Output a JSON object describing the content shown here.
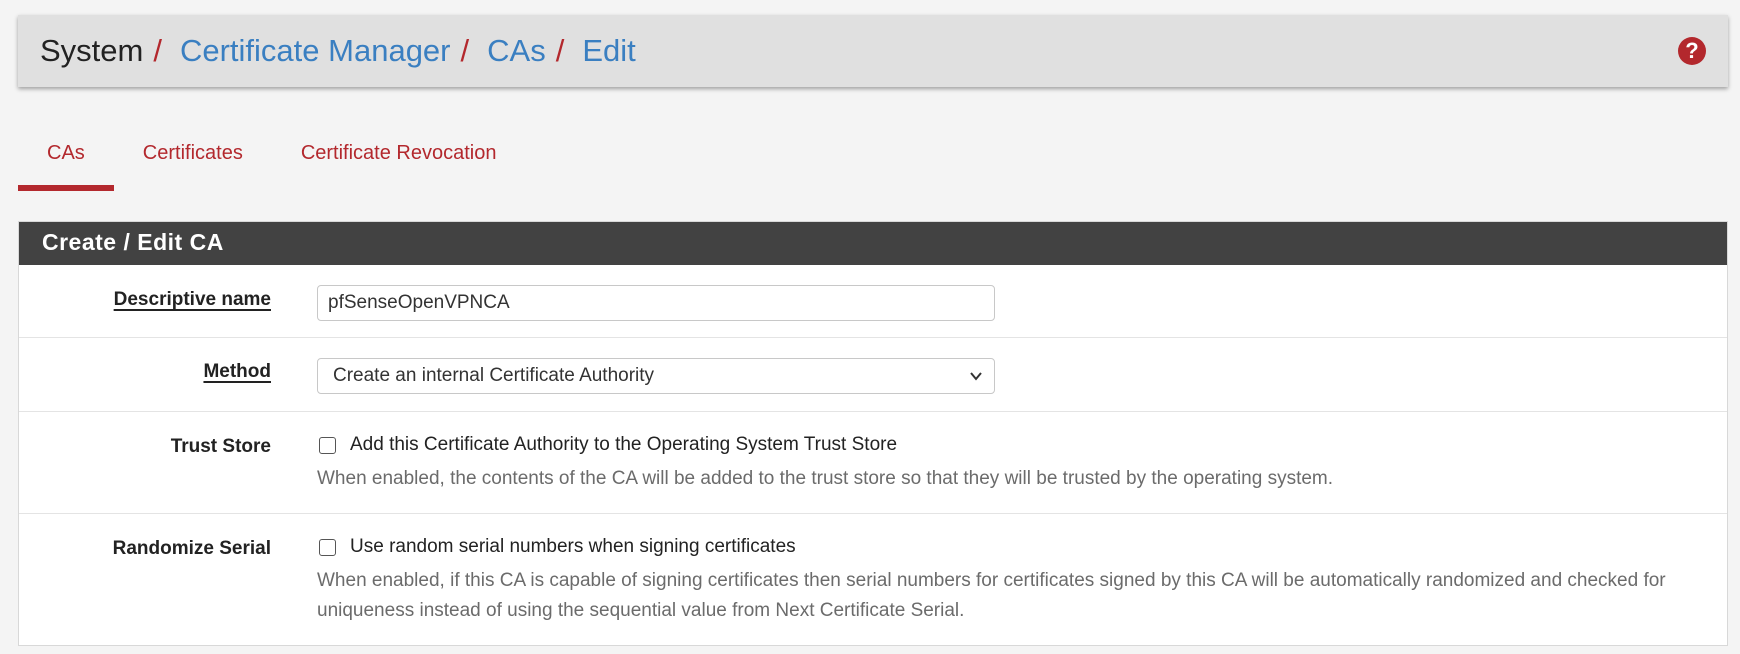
{
  "breadcrumb": {
    "root": "System",
    "separator": "/",
    "links": [
      "Certificate Manager",
      "CAs",
      "Edit"
    ]
  },
  "help_icon": "question-circle-icon",
  "tabs": [
    {
      "label": "CAs",
      "active": true
    },
    {
      "label": "Certificates",
      "active": false
    },
    {
      "label": "Certificate Revocation",
      "active": false
    }
  ],
  "panel": {
    "title": "Create / Edit CA"
  },
  "form": {
    "descriptive_name": {
      "label": "Descriptive name",
      "value": "pfSenseOpenVPNCA"
    },
    "method": {
      "label": "Method",
      "selected": "Create an internal Certificate Authority"
    },
    "trust_store": {
      "label": "Trust Store",
      "checkbox_label": "Add this Certificate Authority to the Operating System Trust Store",
      "checked": false,
      "help": "When enabled, the contents of the CA will be added to the trust store so that they will be trusted by the operating system."
    },
    "randomize_serial": {
      "label": "Randomize Serial",
      "checkbox_label": "Use random serial numbers when signing certificates",
      "checked": false,
      "help": "When enabled, if this CA is capable of signing certificates then serial numbers for certificates signed by this CA will be automatically randomized and checked for uniqueness instead of using the sequential value from Next Certificate Serial."
    }
  },
  "colors": {
    "accent_red": "#b3282d",
    "link_blue": "#3a7fc1",
    "panel_heading_bg": "#424242",
    "page_bg": "#f4f4f4"
  }
}
